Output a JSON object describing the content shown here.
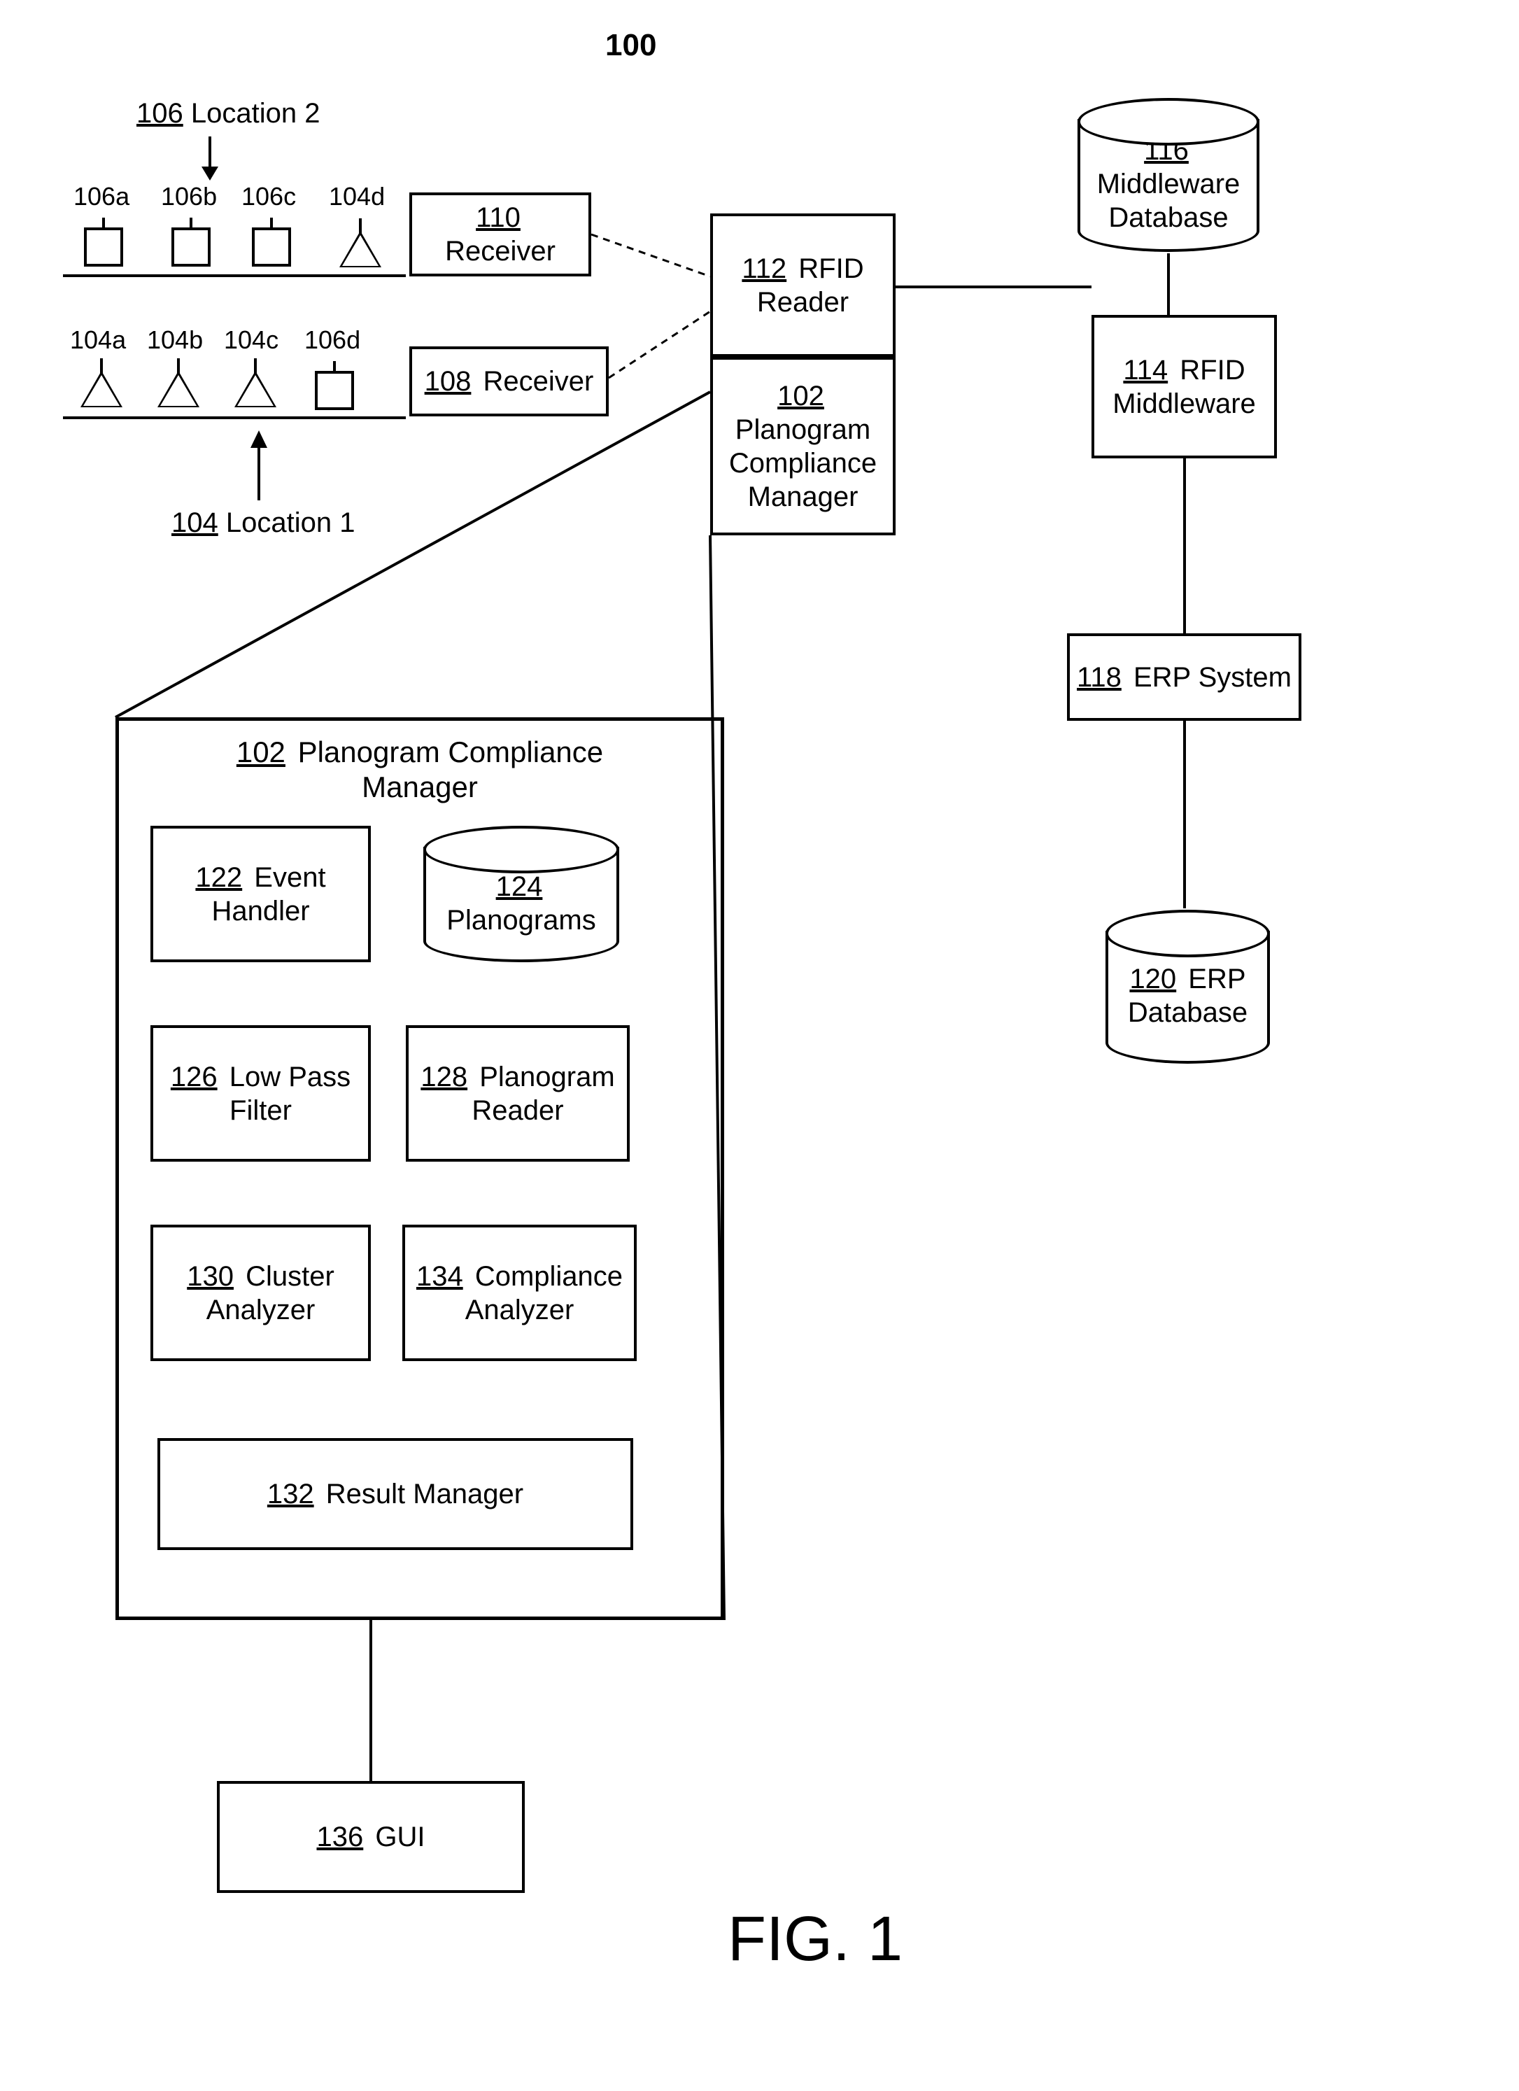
{
  "title_ref": "100",
  "fig": "FIG. 1",
  "location2": {
    "ref": "106",
    "label": "Location 2"
  },
  "location1": {
    "ref": "104",
    "label": "Location 1"
  },
  "shelf2_tags": [
    "106a",
    "106b",
    "106c",
    "104d"
  ],
  "shelf1_tags": [
    "104a",
    "104b",
    "104c",
    "106d"
  ],
  "receiver110": {
    "ref": "110",
    "label": "Receiver"
  },
  "receiver108": {
    "ref": "108",
    "label": "Receiver"
  },
  "rfid_reader": {
    "ref": "112",
    "label": "RFID Reader"
  },
  "pcm_small": {
    "ref": "102",
    "label": "Planogram Compliance Manager"
  },
  "mw_db": {
    "ref": "116",
    "label": "Middleware Database"
  },
  "rfid_mw": {
    "ref": "114",
    "label": "RFID Middleware"
  },
  "erp_sys": {
    "ref": "118",
    "label": "ERP System"
  },
  "erp_db": {
    "ref": "120",
    "label": "ERP Database"
  },
  "pcm_big": {
    "ref": "102",
    "label": "Planogram Compliance Manager"
  },
  "event_handler": {
    "ref": "122",
    "label": "Event Handler"
  },
  "planograms": {
    "ref": "124",
    "label": "Planograms"
  },
  "lowpass": {
    "ref": "126",
    "label": "Low Pass Filter"
  },
  "plano_reader": {
    "ref": "128",
    "label": "Planogram Reader"
  },
  "cluster": {
    "ref": "130",
    "label": "Cluster Analyzer"
  },
  "compliance": {
    "ref": "134",
    "label": "Compliance Analyzer"
  },
  "result_mgr": {
    "ref": "132",
    "label": "Result Manager"
  },
  "gui": {
    "ref": "136",
    "label": "GUI"
  }
}
